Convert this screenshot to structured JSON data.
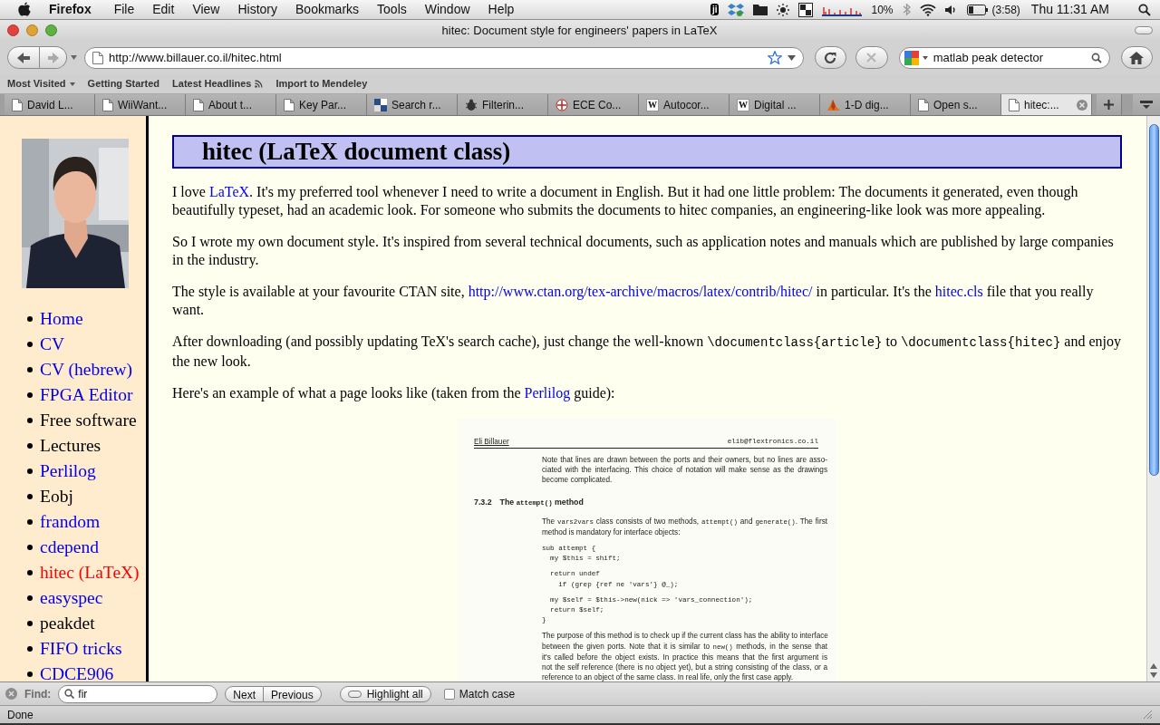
{
  "menubar": {
    "app": "Firefox",
    "items": [
      "File",
      "Edit",
      "View",
      "History",
      "Bookmarks",
      "Tools",
      "Window",
      "Help"
    ],
    "extras_badge": "ji",
    "battery_percent": "10%",
    "battery_time": "(3:58)",
    "clock": "Thu 11:31 AM"
  },
  "window": {
    "title": "hitec: Document style for engineers' papers in LaTeX"
  },
  "toolbar": {
    "url": "http://www.billauer.co.il/hitec.html",
    "search": "matlab peak detector",
    "forward_enabled": false,
    "stop_enabled": false
  },
  "bookmarks": [
    {
      "label": "Most Visited",
      "kind": "folder"
    },
    {
      "label": "Getting Started",
      "kind": "link"
    },
    {
      "label": "Latest Headlines",
      "kind": "feed"
    },
    {
      "label": "Import to Mendeley",
      "kind": "link"
    }
  ],
  "tabs": [
    {
      "label": "David L...",
      "kind": "page",
      "selected": false
    },
    {
      "label": "WiiWant...",
      "kind": "page",
      "selected": false
    },
    {
      "label": "About t...",
      "kind": "page",
      "selected": false
    },
    {
      "label": "Key Par...",
      "kind": "page",
      "selected": false
    },
    {
      "label": "Search r...",
      "kind": "grid",
      "selected": false
    },
    {
      "label": "Filterin...",
      "kind": "bug",
      "selected": false
    },
    {
      "label": "ECE Co...",
      "kind": "emblem",
      "selected": false
    },
    {
      "label": "Autocor...",
      "kind": "wiki",
      "glyph": "W",
      "selected": false
    },
    {
      "label": "Digital ...",
      "kind": "wiki",
      "glyph": "W",
      "selected": false
    },
    {
      "label": "1-D dig...",
      "kind": "peak",
      "selected": false
    },
    {
      "label": "Open s...",
      "kind": "page",
      "selected": false
    },
    {
      "label": "hitec:...",
      "kind": "page",
      "selected": true
    }
  ],
  "sidebar": {
    "items": [
      {
        "label": "Home",
        "visited": false,
        "selected": false
      },
      {
        "label": "CV",
        "visited": false,
        "selected": false
      },
      {
        "label": "CV (hebrew)",
        "visited": false,
        "selected": false
      },
      {
        "label": "FPGA Editor",
        "visited": false,
        "selected": false
      },
      {
        "label": "Free software",
        "visited": true,
        "selected": false
      },
      {
        "label": "Lectures",
        "visited": true,
        "selected": false
      },
      {
        "label": "Perlilog",
        "visited": false,
        "selected": false
      },
      {
        "label": "Eobj",
        "visited": true,
        "selected": false
      },
      {
        "label": "frandom",
        "visited": false,
        "selected": false
      },
      {
        "label": "cdepend",
        "visited": false,
        "selected": false
      },
      {
        "label": "hitec (LaTeX)",
        "visited": false,
        "selected": true
      },
      {
        "label": "easyspec",
        "visited": false,
        "selected": false
      },
      {
        "label": "peakdet",
        "visited": true,
        "selected": false
      },
      {
        "label": "FIFO tricks",
        "visited": false,
        "selected": false
      },
      {
        "label": "CDCE906",
        "visited": false,
        "selected": false
      }
    ]
  },
  "page": {
    "heading": "hitec (LaTeX document class)",
    "paragraphs": [
      [
        {
          "kind": "text",
          "text": "I love "
        },
        {
          "kind": "link",
          "text": "LaTeX"
        },
        {
          "kind": "text",
          "text": ". It's my preferred tool whenever I need to write a document in English. But it had one little problem: The documents it generated, even though beautifully typeset, had an academic look. For someone who submits the documents to hitec companies, an engineering-like look was more appealing."
        }
      ],
      [
        {
          "kind": "text",
          "text": "So I wrote my own document style. It's inspired from several technical documents, such as application notes and manuals which are published by large companies in the industry."
        }
      ],
      [
        {
          "kind": "text",
          "text": "The style is available at your favourite CTAN site, "
        },
        {
          "kind": "link",
          "text": "http://www.ctan.org/tex-archive/macros/latex/contrib/hitec/"
        },
        {
          "kind": "text",
          "text": " in particular. It's the "
        },
        {
          "kind": "link",
          "text": "hitec.cls"
        },
        {
          "kind": "text",
          "text": " file that you really want."
        }
      ],
      [
        {
          "kind": "text",
          "text": "After downloading (and possibly updating TeX's search cache), just change the well-known "
        },
        {
          "kind": "code",
          "text": "\\documentclass{article}"
        },
        {
          "kind": "text",
          "text": " to "
        },
        {
          "kind": "code",
          "text": "\\documentclass{hitec}"
        },
        {
          "kind": "text",
          "text": " and enjoy the new look."
        }
      ],
      [
        {
          "kind": "text",
          "text": "Here's an example of what a page looks like (taken from the "
        },
        {
          "kind": "link",
          "text": "Perlilog"
        },
        {
          "kind": "text",
          "text": " guide):"
        }
      ]
    ],
    "document": {
      "author": "Eli Billauer",
      "email": "elib@flextronics.co.il",
      "blocks": [
        {
          "kind": "para",
          "lines": [
            "Note that lines are drawn between the ports and their owners, but no lines are asso-",
            "ciated with the interfacing. This choice of notation will make sense as the drawings",
            "become complicated."
          ]
        },
        {
          "kind": "heading",
          "number": "7.3.2",
          "segments": [
            {
              "kind": "text",
              "text": "The "
            },
            {
              "kind": "code",
              "text": "attempt()"
            },
            {
              "kind": "text",
              "text": " method"
            }
          ]
        },
        {
          "kind": "para",
          "lines": [
            [
              {
                "kind": "text",
                "text": "The "
              },
              {
                "kind": "code",
                "text": "vars2vars"
              },
              {
                "kind": "text",
                "text": " class consists of two methods, "
              },
              {
                "kind": "code",
                "text": "attempt()"
              },
              {
                "kind": "text",
                "text": " and "
              },
              {
                "kind": "code",
                "text": "generate()"
              },
              {
                "kind": "text",
                "text": ". The first"
              }
            ],
            "method is mandatory for interface objects:"
          ]
        },
        {
          "kind": "code",
          "lines": [
            "sub attempt {",
            "  my $this = shift;"
          ]
        },
        {
          "kind": "code",
          "lines": [
            "  return undef",
            "    if (grep {ref ne 'vars'} @_);"
          ]
        },
        {
          "kind": "code",
          "lines": [
            "  my $self = $this->new(nick => 'vars_connection');",
            "  return $self;",
            "}"
          ]
        },
        {
          "kind": "para",
          "lines": [
            "The purpose of this method is to check up if the current class has the ability to interface",
            [
              {
                "kind": "text",
                "text": "between the given ports. Note that it is similar to "
              },
              {
                "kind": "code",
                "text": "new()"
              },
              {
                "kind": "text",
                "text": " methods, in the sense that"
              }
            ],
            "it's called before the object exists. In practice this means that the first argument is",
            "not the self reference (there is no object yet), but a string consisting of the class, or a",
            "reference to an object of the same class. In real life, only the first case apply."
          ]
        }
      ]
    }
  },
  "find_bar": {
    "label": "Find:",
    "value": "fir",
    "buttons": [
      "Next",
      "Previous"
    ],
    "highlight": "Highlight all",
    "match_case": {
      "label": "Match case",
      "checked": false
    }
  },
  "status_bar": "Done"
}
